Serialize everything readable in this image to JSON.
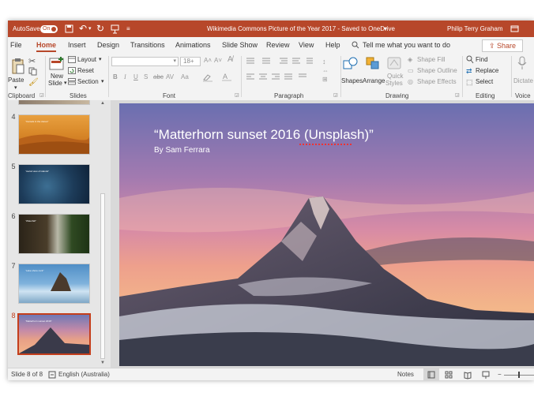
{
  "titlebar": {
    "autosave_label": "AutoSave",
    "autosave_state": "On",
    "doc_title": "Wikimedia Commons Picture of the Year 2017  -  Saved to OneDrive",
    "user": "Philip Terry Graham"
  },
  "tabs": [
    "File",
    "Home",
    "Insert",
    "Design",
    "Transitions",
    "Animations",
    "Slide Show",
    "Review",
    "View",
    "Help"
  ],
  "active_tab": "Home",
  "tell_me": "Tell me what you want to do",
  "share_label": "Share",
  "ribbon": {
    "clipboard": {
      "paste": "Paste",
      "group": "Clipboard"
    },
    "slides": {
      "new_slide_1": "New",
      "new_slide_2": "Slide",
      "layout": "Layout",
      "reset": "Reset",
      "section": "Section",
      "group": "Slides"
    },
    "font": {
      "size": "18+",
      "group": "Font",
      "bold": "B",
      "italic": "I",
      "underline": "U",
      "shadow": "S",
      "strike": "abc",
      "spacing": "AV",
      "case": "Aa"
    },
    "paragraph": {
      "group": "Paragraph"
    },
    "drawing": {
      "shapes": "Shapes",
      "arrange": "Arrange",
      "quick_1": "Quick",
      "quick_2": "Styles",
      "fill": "Shape Fill",
      "outline": "Shape Outline",
      "effects": "Shape Effects",
      "group": "Drawing"
    },
    "editing": {
      "find": "Find",
      "replace": "Replace",
      "select": "Select",
      "group": "Editing"
    },
    "voice": {
      "dictate": "Dictate",
      "group": "Voice"
    }
  },
  "slides": [
    {
      "num": "4",
      "caption": "“Camels in the dunes”"
    },
    {
      "num": "5",
      "caption": "“Aerial view of islands”"
    },
    {
      "num": "6",
      "caption": "“Waterfall”"
    },
    {
      "num": "7",
      "caption": "“Lake shore rock”"
    },
    {
      "num": "8",
      "caption": "“Matterhorn sunset 2016”"
    }
  ],
  "current_slide": {
    "title": "“Matterhorn sunset 2016 (Unsplash)”",
    "subtitle": "By Sam Ferrara"
  },
  "status": {
    "slide_info": "Slide 8 of 8",
    "language": "English (Australia)",
    "notes": "Notes"
  },
  "colors": {
    "accent": "#b7472a",
    "selection": "#c43e1c"
  }
}
